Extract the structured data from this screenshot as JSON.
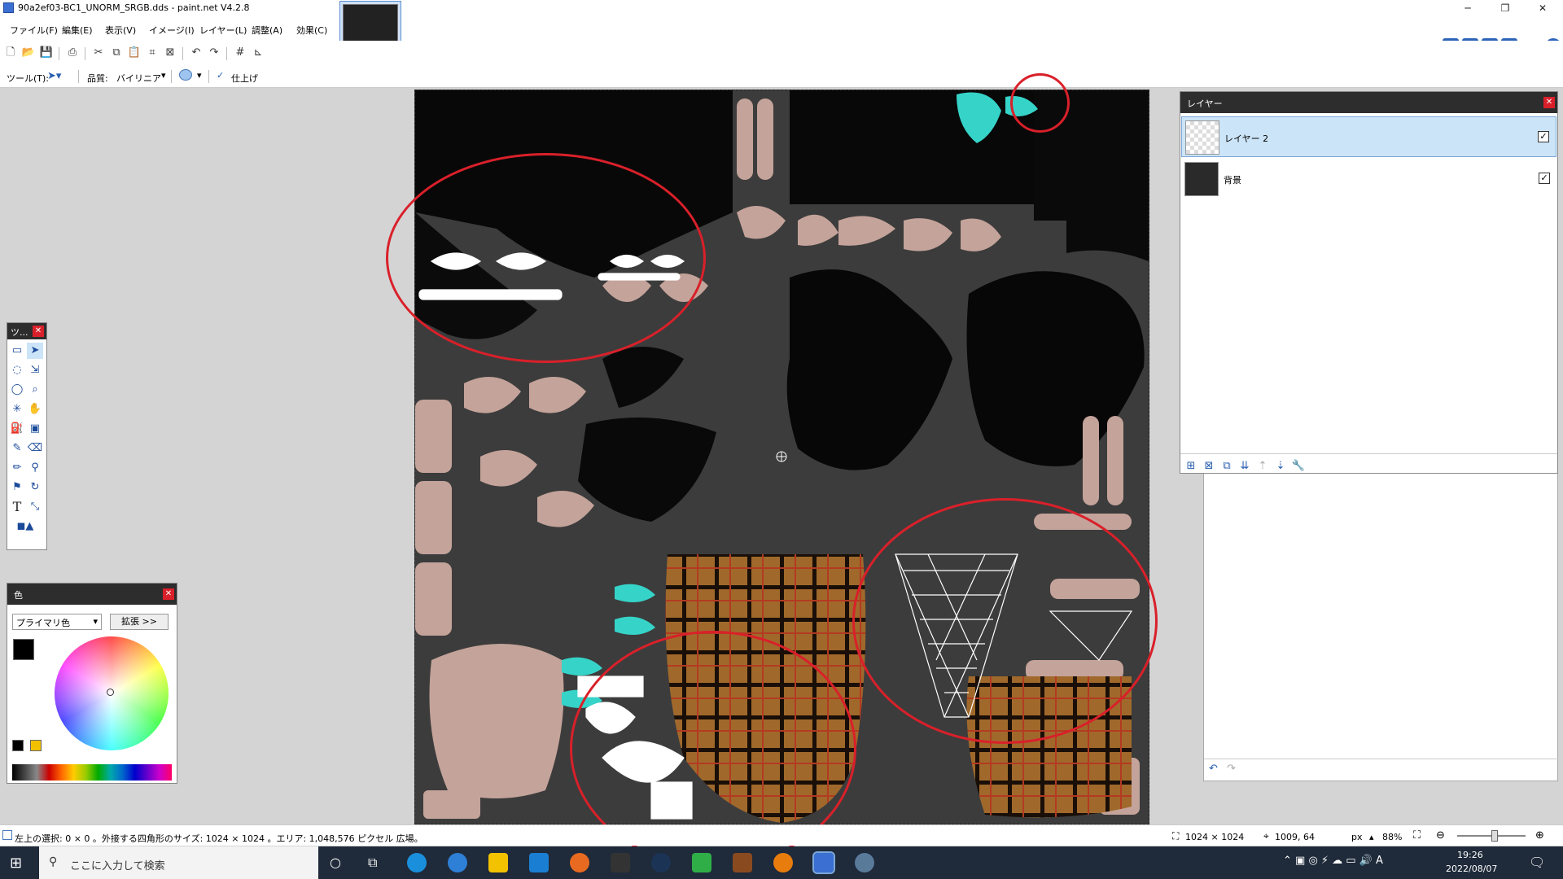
{
  "window": {
    "title": "90a2ef03-BC1_UNORM_SRGB.dds - paint.net V4.2.8"
  },
  "menu": [
    "ファイル(F)",
    "編集(E)",
    "表示(V)",
    "イメージ(I)",
    "レイヤー(L)",
    "調整(A)",
    "効果(C)"
  ],
  "toolbar2": {
    "tool_label": "ツール(T):",
    "quality_label": "品質:",
    "quality_value": "バイリニア",
    "finish_label": "仕上げ"
  },
  "tools_window": {
    "title": "ツ..."
  },
  "colors_window": {
    "title": "色",
    "mode": "プライマリ色",
    "expand_button": "拡張 >>"
  },
  "layers_window": {
    "title": "レイヤー",
    "layers": [
      {
        "name": "レイヤー 2",
        "visible": true,
        "selected": true
      },
      {
        "name": "背景",
        "visible": true,
        "selected": false
      }
    ]
  },
  "status": {
    "selection_info": "左上の選択: 0 × 0 。外接する四角形のサイズ: 1024 × 1024 。エリア: 1,048,576 ピクセル 広場。",
    "image_size": "1024 × 1024",
    "cursor_pos": "1009, 64",
    "unit": "px",
    "zoom": "88%"
  },
  "taskbar": {
    "search_placeholder": "ここに入力して検索",
    "time": "19:26",
    "date": "2022/08/07"
  },
  "colors": {
    "accent": "#d9202a",
    "selection_blue": "#cce4f7",
    "teal": "#36d3c8",
    "canvas_bg": "#3c3c3c"
  }
}
